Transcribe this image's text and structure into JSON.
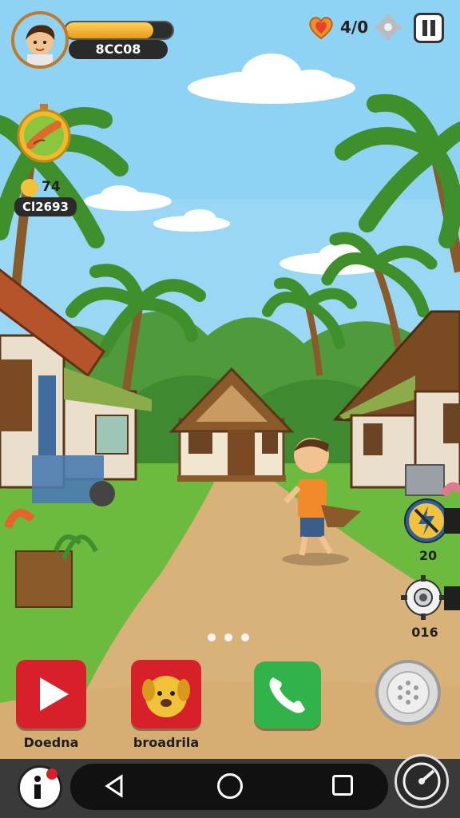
{
  "hud": {
    "xp_progress": 0.82,
    "coins_label": "8CC08",
    "lives_label": "4/0",
    "avatar_icon": "boy-avatar",
    "heart_icon": "heart-icon",
    "settings_icon": "gear-icon",
    "pause_icon": "pause-icon"
  },
  "quest": {
    "icon": "sausage-badge-icon",
    "smile_count": "74",
    "score_label": "Cl2693"
  },
  "side_buttons": [
    {
      "icon": "lightning-badge-icon",
      "label": "20"
    },
    {
      "icon": "gear-badge-icon",
      "label": "016"
    }
  ],
  "page_indicator": {
    "count": 3
  },
  "dock": [
    {
      "icon": "play-icon",
      "label": "Doedna",
      "color": "#d8202a"
    },
    {
      "icon": "dog-icon",
      "label": "broadrila",
      "color": "#d8202a"
    },
    {
      "icon": "phone-icon",
      "label": "",
      "color": "#2fb34a"
    },
    {
      "icon": "speaker-icon",
      "label": "",
      "color": "#d9d9d9"
    }
  ],
  "navbar": {
    "left_icon": "info-icon",
    "back_icon": "back-icon",
    "home_icon": "home-icon",
    "recents_icon": "recents-icon",
    "right_icon": "speedometer-icon"
  }
}
